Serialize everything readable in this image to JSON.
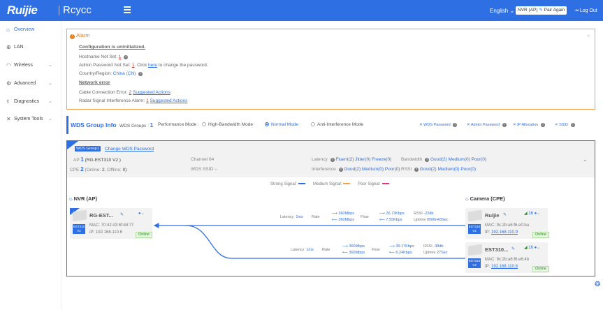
{
  "header": {
    "logo": "Ruijie",
    "brand": "Rcycc",
    "language": "English",
    "device_label": "NVR (AP)",
    "pair_again": "Pair Again",
    "logout": "Log Out",
    "accent_color": "#2f6fe4"
  },
  "sidebar": {
    "items": [
      {
        "label": "Overview",
        "icon": "home-icon"
      },
      {
        "label": "LAN",
        "icon": "globe-icon"
      },
      {
        "label": "Wireless",
        "icon": "wifi-icon"
      },
      {
        "label": "Advanced",
        "icon": "gear-icon"
      },
      {
        "label": "Diagnostics",
        "icon": "diagnostics-icon"
      },
      {
        "label": "System Tools",
        "icon": "tools-icon"
      }
    ]
  },
  "alarm": {
    "title": "Alarm",
    "uninit": "Configuration is uninitialized.",
    "hostname_label": "Hostname Not Set:",
    "hostname_count": "1",
    "admin_pw_label": "Admin Password Not Set:",
    "admin_pw_count": "1",
    "admin_pw_click": ". Click",
    "admin_pw_here": "here",
    "admin_pw_tail": "to change the password.",
    "country_label": "Country/Region:",
    "country_value": "China (CN)",
    "network_error": "Network error",
    "cable_label": "Cable Connection Error:",
    "cable_count": "2",
    "cable_action": "Suggested Actions",
    "radar_label": "Radar Signal Interference Alarm:",
    "radar_count": "1",
    "radar_action": "Suggested Actions"
  },
  "wds": {
    "title": "WDS Group Info",
    "groups_label": "WDS Groups :",
    "groups_count": "1",
    "perf_label": "Performance Mode :",
    "modes": [
      "High-Bandwidth Mode",
      "Normal Mode",
      "Anti-Interference Mode"
    ],
    "selected_mode": "Normal Mode",
    "links": [
      "WDS Password",
      "Admin Password",
      "IP Allocation",
      "SSID"
    ]
  },
  "group": {
    "badge": "WDS Group1",
    "change_pw": "Change WDS Password",
    "ap_label": "AP",
    "ap_count": "1",
    "ap_model": "(RG-EST310 V2 )",
    "cpe_label": "CPE",
    "cpe_count": "2",
    "cpe_online_label": "(Online:",
    "cpe_online": "2",
    "cpe_offline_label": ", Offline:",
    "cpe_offline": "0)",
    "channel_label": "Channel",
    "channel": "64",
    "ssid_label": "WDS SSID",
    "ssid": "--",
    "latency_label": "Latency",
    "latency_vals": [
      "Fluent(2)",
      "Jitter(0)",
      "Freeze(0)"
    ],
    "interference_label": "Interference",
    "interference_vals": [
      "Good(2)",
      "Medium(0)",
      "Poor(0)"
    ],
    "bandwidth_label": "Bandwidth",
    "bandwidth_vals": [
      "Good(2)",
      "Medium(0)",
      "Poor(0)"
    ],
    "rssi_label": "RSSI",
    "rssi_vals": [
      "Good(2)",
      "Medium(0)",
      "Poor(0)"
    ]
  },
  "legend": {
    "strong": "Strong Signal:",
    "medium": "Medium Signal:",
    "poor": "Poor Signal:",
    "strong_color": "#2f6fe4",
    "medium_color": "#f5a04a",
    "poor_color": "#e0348b"
  },
  "nvr": {
    "title": "NVR (AP)",
    "name": "RG-EST...",
    "mac_label": "MAC:",
    "mac": "70:42:d3:6f:dd:77",
    "ip_label": "IP:",
    "ip": "192.168.110.6",
    "status": "Online",
    "tag": "EST310 V2"
  },
  "camera": {
    "title": "Camera (CPE)",
    "devices": [
      {
        "name": "Ruijie",
        "mac_label": "MAC:",
        "mac": "9c:2b:a6:f6:e0:ba",
        "ip_label": "IP:",
        "ip": "192.168.110.9",
        "status": "Online",
        "signal": "16",
        "tag": "EST310 V2"
      },
      {
        "name": "EST310...",
        "mac_label": "MAC:",
        "mac": "9c:2b:a6:f6:e6:4b",
        "ip_label": "IP:",
        "ip": "192.168.110.8",
        "status": "Online",
        "signal": "16",
        "tag": "EST310 V2"
      }
    ]
  },
  "links": [
    {
      "latency_label": "Latency",
      "latency": "1ms",
      "rate_label": "Rate",
      "rate_up": "360Mbps",
      "rate_down": "360Mbps",
      "flow_label": "Flow",
      "flow_up": "26.73Kbps",
      "flow_down": "7.55Kbps",
      "rssi_label": "RSSI",
      "rssi": "-22db",
      "uptime_label": "Uptime",
      "uptime": "05Min43Sec"
    },
    {
      "latency_label": "Latency",
      "latency": "1ms",
      "rate_label": "Rate",
      "rate_up": "360Mbps",
      "rate_down": "360Mbps",
      "flow_label": "Flow",
      "flow_up": "39.17Kbps",
      "flow_down": "6.24Kbps",
      "rssi_label": "RSSI",
      "rssi": "-38db",
      "uptime_label": "Uptime",
      "uptime": "27Sec"
    }
  ]
}
